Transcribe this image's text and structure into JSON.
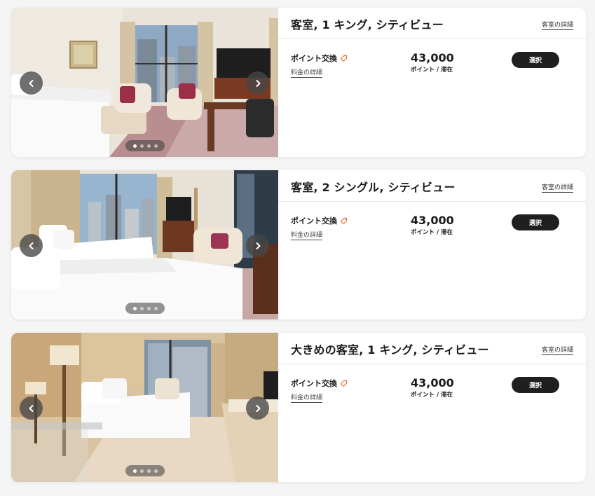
{
  "rooms": [
    {
      "title": "客室, 1 キング, シティビュー",
      "room_detail_link": "客室の詳細",
      "rate_label": "ポイント交換",
      "rate_detail_link": "料金の詳細",
      "points": "43,000",
      "per_stay": "ポイント / 滞在",
      "select_label": "選択",
      "carousel": {
        "total_slides": 4,
        "active_slide": 1
      }
    },
    {
      "title": "客室, 2 シングル, シティビュー",
      "room_detail_link": "客室の詳細",
      "rate_label": "ポイント交換",
      "rate_detail_link": "料金の詳細",
      "points": "43,000",
      "per_stay": "ポイント / 滞在",
      "select_label": "選択",
      "carousel": {
        "total_slides": 4,
        "active_slide": 1
      }
    },
    {
      "title": "大きめの客室, 1 キング, シティビュー",
      "room_detail_link": "客室の詳細",
      "rate_label": "ポイント交換",
      "rate_detail_link": "料金の詳細",
      "points": "43,000",
      "per_stay": "ポイント / 滞在",
      "select_label": "選択",
      "carousel": {
        "total_slides": 4,
        "active_slide": 1
      }
    }
  ],
  "icons": {
    "prev": "chevron-left-icon",
    "next": "chevron-right-icon",
    "rate_tag": "tag-icon"
  },
  "colors": {
    "select_button": "#1f1f1f",
    "tag_icon": "#e0783c",
    "card_background": "#ffffff",
    "page_background": "#f5f5f5"
  }
}
